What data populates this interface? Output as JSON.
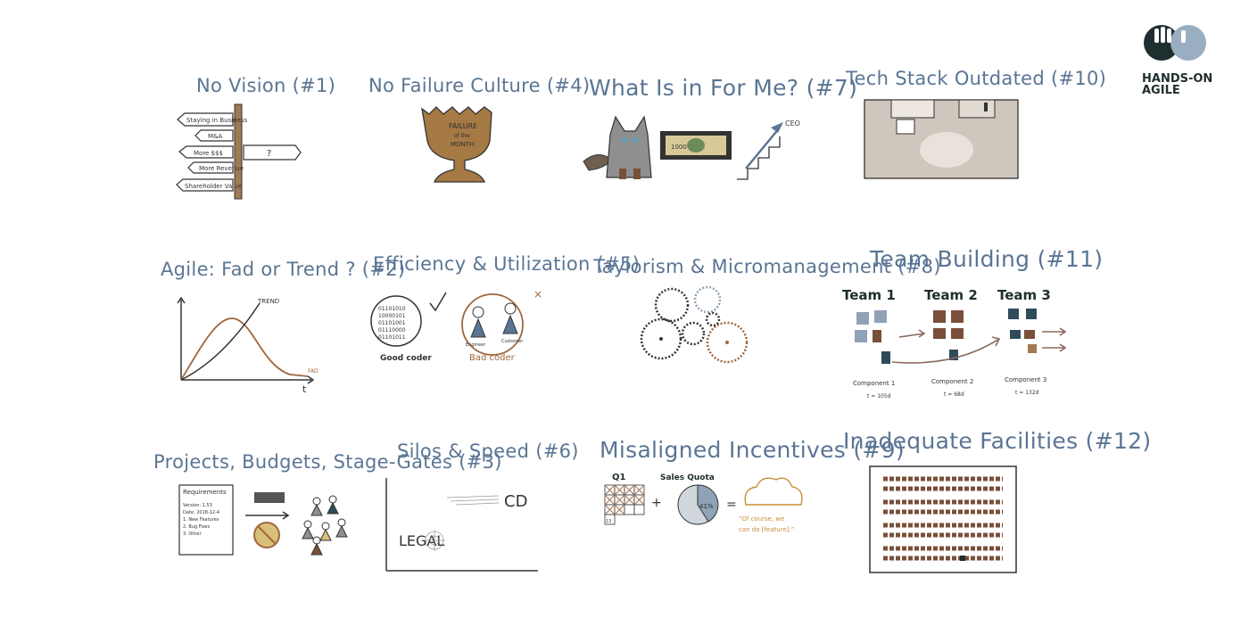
{
  "logo": {
    "line1": "HANDS-ON",
    "line2": "AGILE"
  },
  "panels": {
    "p1": {
      "title": "No Vision (#1)",
      "signs": [
        "Staying in Business",
        "M&A",
        "More $$$",
        "More Revenue",
        "Shareholder Value"
      ],
      "right_sign": "?"
    },
    "p4": {
      "title": "No Failure Culture (#4)",
      "trophy_lines": [
        "FAILURE",
        "of the",
        "MONTH"
      ]
    },
    "p7": {
      "title": "What Is in For Me? (#7)",
      "ceo": "CEO",
      "bill": "1000"
    },
    "p10": {
      "title": "Tech Stack Outdated (#10)"
    },
    "p2": {
      "title": "Agile: Fad or Trend ? (#2)",
      "trend": "TREND",
      "fad": "FAD",
      "axis_t": "t"
    },
    "p5": {
      "title": "Efficiency & Utilization (#5)",
      "binary": [
        "01101010",
        "10000101",
        "01101001",
        "01110000",
        "01101011"
      ],
      "good": "Good coder",
      "bad": "Bad coder",
      "engineer": "Engineer",
      "customer": "Customer"
    },
    "p8": {
      "title": "Taylorism & Micromanagement (#8)"
    },
    "p11": {
      "title": "Team Building (#11)",
      "teams": [
        "Team 1",
        "Team 2",
        "Team 3"
      ],
      "components": [
        "Component 1",
        "Component 2",
        "Component 3"
      ],
      "times": [
        "t = 105d",
        "t = 68d",
        "t = 132d"
      ]
    },
    "p3": {
      "title": "Projects, Budgets, Stage-Gates (#3)",
      "doc_lines": [
        "Requirements",
        "Version: 1.53",
        "Date: 2018-12-4",
        "1. New Features",
        "2. Bug Fixes",
        "3. Other"
      ]
    },
    "p6": {
      "title": "Silos & Speed (#6)",
      "cd": "CD",
      "legal": "LEGAL"
    },
    "p9": {
      "title": "Misaligned Incentives (#9)",
      "q1": "Q1",
      "sales": "Sales Quota",
      "pct": "41%",
      "quote_l1": "“Of course, we",
      "quote_l2": "can do [feature].”",
      "grid": [
        "1",
        "2",
        "3",
        "4",
        "5",
        "6",
        "7",
        "8",
        "9",
        "10",
        "11",
        "12",
        "13"
      ]
    },
    "p12": {
      "title": "Inadequate Facilities (#12)"
    }
  }
}
